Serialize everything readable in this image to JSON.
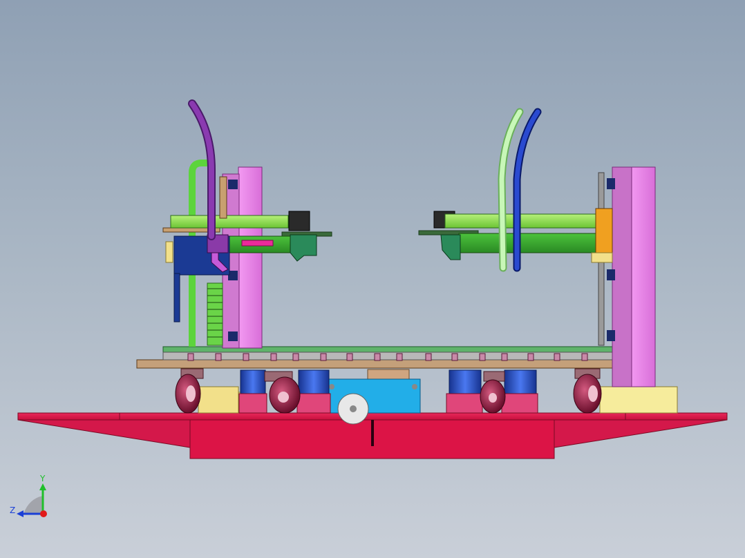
{
  "app": {
    "view": "cad-3d-viewport"
  },
  "triad": {
    "y_label": "Y",
    "z_label": "Z",
    "y_color": "#1fbf2a",
    "z_color": "#1a3fd6",
    "x_color": "#e11a1a"
  },
  "colors": {
    "base_red": "#dc1446",
    "pillar_pink": "#ee82ee",
    "arm_green": "#8ee04a",
    "arm_dark_green": "#3ea82e",
    "plate_tan": "#c4a07a",
    "plate_green": "#5fb36a",
    "caster_maroon": "#8a1a3c",
    "motor_blue": "#1f4fc8",
    "drive_cyan": "#22aee8",
    "hose_purple": "#7a2a98",
    "hose_lightgreen": "#b6f0a6",
    "hose_blue": "#1c3cb8",
    "block_yellow": "#f2e08a",
    "bracket_navy": "#1b3a94"
  }
}
